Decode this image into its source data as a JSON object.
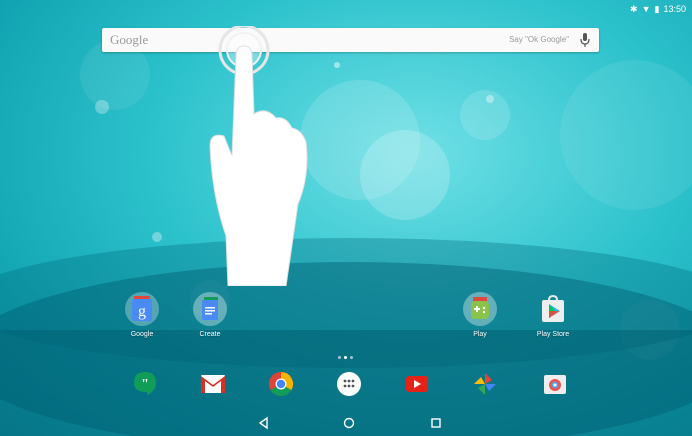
{
  "status_bar": {
    "icons": [
      "bluetooth-icon",
      "wifi-icon",
      "battery-icon"
    ],
    "time": "13:50"
  },
  "search": {
    "logo": "Google",
    "hint": "Say \"Ok Google\"",
    "icons": [
      "microphone-icon"
    ]
  },
  "home_apps": [
    {
      "label": "Google",
      "icon": "google-search-icon"
    },
    {
      "label": "Create",
      "icon": "google-docs-folder-icon"
    },
    {
      "label": "Play",
      "icon": "play-games-folder-icon"
    },
    {
      "label": "Play Store",
      "icon": "play-store-icon"
    }
  ],
  "dock": [
    "hangouts-icon",
    "gmail-icon",
    "chrome-icon",
    "app-drawer-icon",
    "youtube-icon",
    "photos-icon",
    "camera-icon"
  ],
  "nav": [
    "back-icon",
    "home-icon",
    "recents-icon"
  ],
  "colors": {
    "wallpaper": "#2cc2cc",
    "search_bg": "#fafafa"
  }
}
